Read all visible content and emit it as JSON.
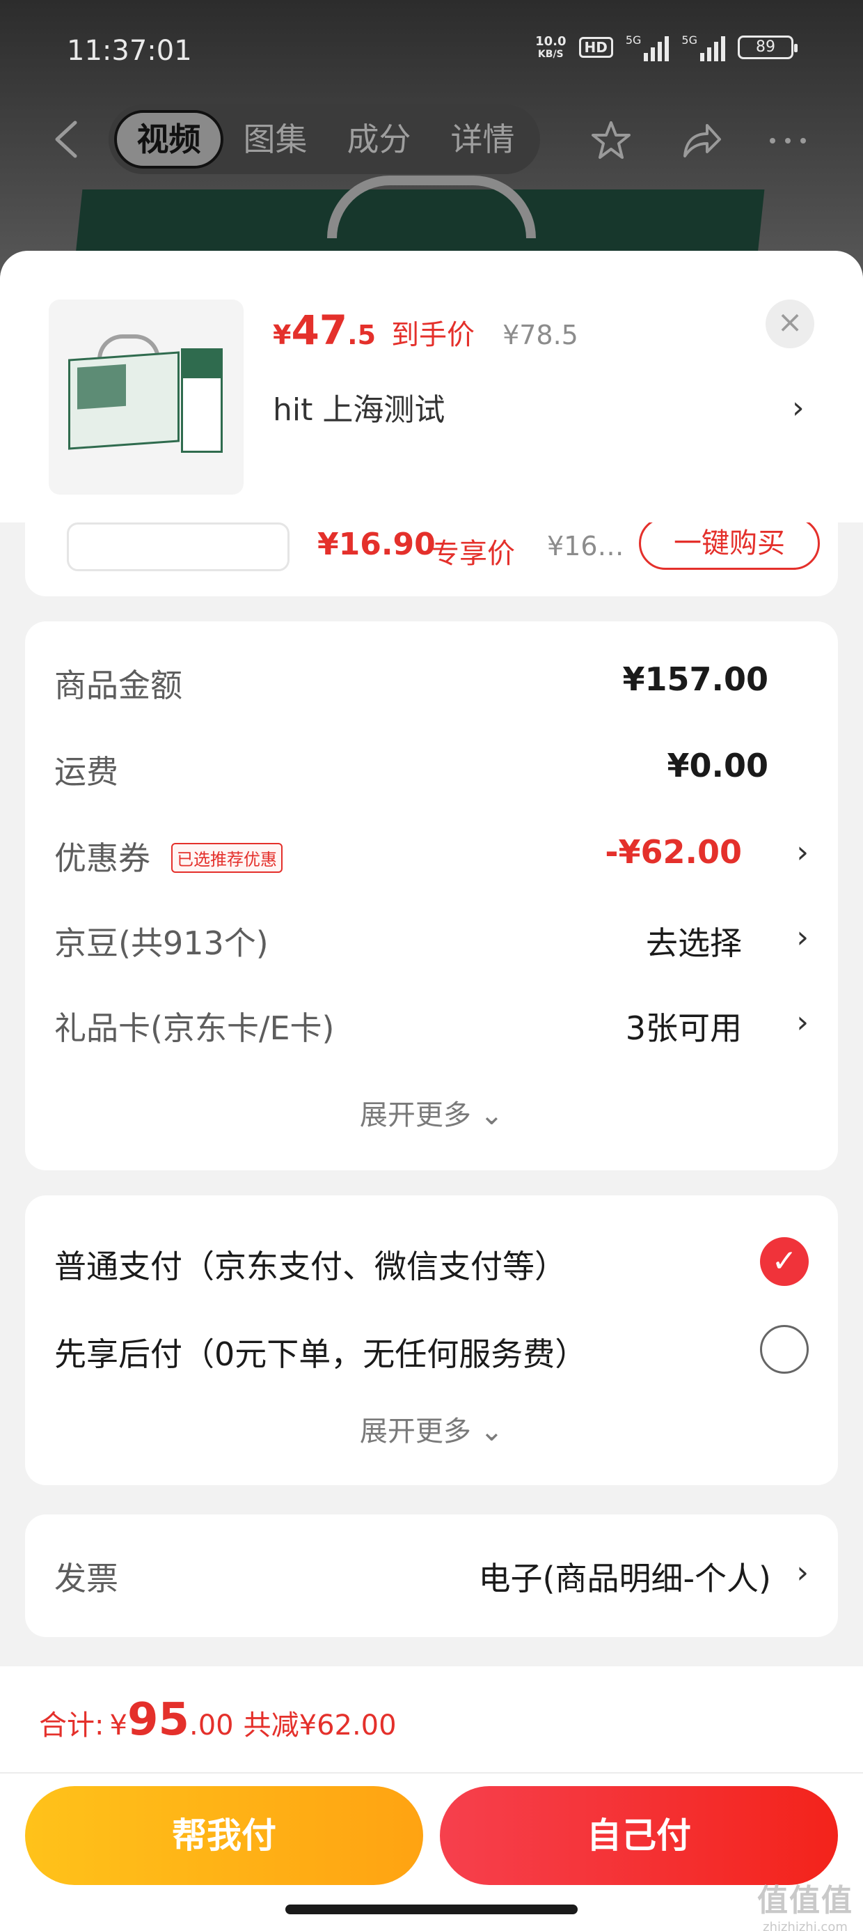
{
  "status_bar": {
    "time": "11:37:01",
    "net_speed_value": "10.0",
    "net_speed_unit": "KB/S",
    "hd_badge": "HD",
    "signal1_label": "5G",
    "signal2_label": "5G",
    "battery": "89"
  },
  "nav": {
    "tabs": [
      "视频",
      "图集",
      "成分",
      "详情"
    ],
    "active_tab": "视频"
  },
  "product": {
    "price_yen": "¥",
    "price_int": "47",
    "price_dec": ".5",
    "price_tag": "到手价",
    "original_price": "¥78.5",
    "address": "hit  上海测试",
    "close_symbol": "×"
  },
  "peek_item": {
    "price": "¥16.90",
    "tag": "专享价",
    "original": "¥16…",
    "buy_label": "一键购买"
  },
  "costs": {
    "goods_label": "商品金额",
    "goods_value": "¥157.00",
    "shipping_label": "运费",
    "shipping_value": "¥0.00",
    "coupon_label": "优惠券",
    "coupon_badge": "已选推荐优惠",
    "coupon_value": "-¥62.00",
    "beans_label": "京豆(共913个)",
    "beans_value": "去选择",
    "giftcard_label": "礼品卡(京东卡/E卡)",
    "giftcard_value": "3张可用",
    "expand_label": "展开更多 ⌄"
  },
  "payment": {
    "option1": "普通支付（京东支付、微信支付等）",
    "option1_checked": true,
    "option2": "先享后付（0元下单，无任何服务费）",
    "option2_checked": false,
    "expand_label": "展开更多 ⌄"
  },
  "invoice": {
    "label": "发票",
    "value": "电子(商品明细-个人)"
  },
  "footer": {
    "total_label": "合计:",
    "total_yen": "¥",
    "total_int": "95",
    "total_dec": ".00",
    "total_saved": "共减¥62.00",
    "help_pay_label": "帮我付",
    "self_pay_label": "自己付"
  },
  "watermark": {
    "logo": "值值值",
    "url": "zhizhizhi.com"
  },
  "colors": {
    "accent_red": "#e4302b",
    "pay_yellow": "#ffb315",
    "pay_red": "#f3231b",
    "check_red": "#f0333a"
  },
  "icons": {
    "back": "chevron-left-icon",
    "favorite": "star-icon",
    "share": "share-icon",
    "more": "more-dots-icon",
    "close": "close-icon",
    "row_arrow": "chevron-right-icon",
    "checked": "check-icon"
  }
}
